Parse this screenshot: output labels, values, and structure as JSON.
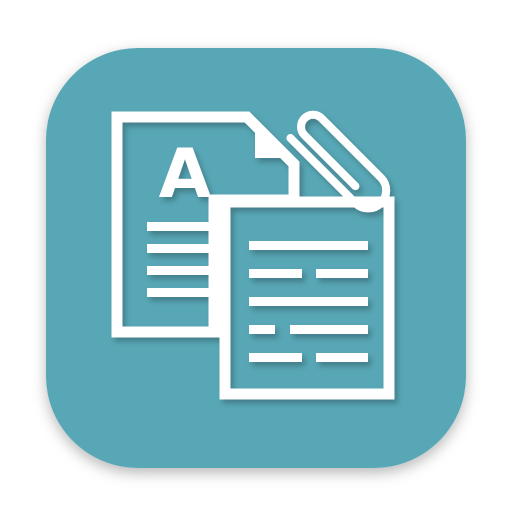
{
  "app_icon": {
    "icon_name": "document-attachment-app-icon",
    "back_document_letter": "A",
    "colors": {
      "tile": "#58a7b6",
      "tile_shadow": "#2f6b76",
      "foreground": "#ffffff"
    }
  }
}
